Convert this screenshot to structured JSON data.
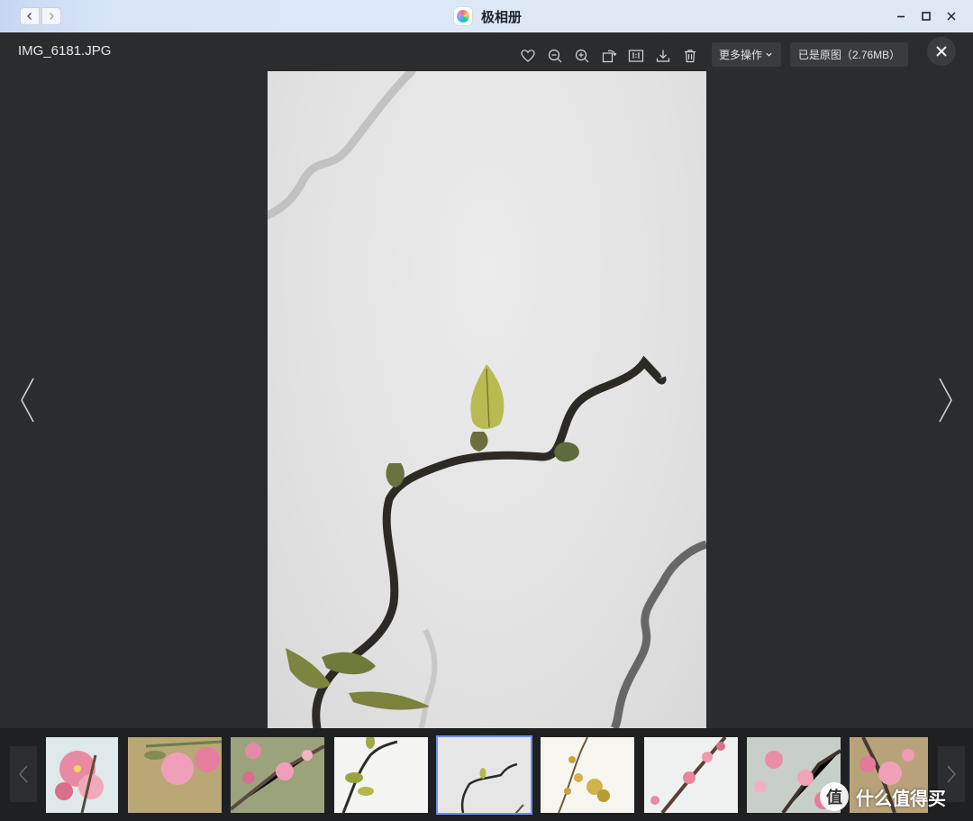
{
  "window": {
    "app_title": "极相册",
    "app_logo_icon": "app-logo-icon"
  },
  "viewer": {
    "file_name": "IMG_6181.JPG",
    "toolbar": {
      "more_actions_label": "更多操作",
      "original_badge": "已是原图（2.76MB）"
    },
    "photo": {
      "subject": "twig-with-new-leaves"
    }
  },
  "filmstrip": {
    "selected_index": 4,
    "thumbnails": [
      {
        "subject": "pink-peach-blossom"
      },
      {
        "subject": "pink-blossom-buds"
      },
      {
        "subject": "pink-blossoms-branch"
      },
      {
        "subject": "twig-leaves-white"
      },
      {
        "subject": "twig-leaves-selected"
      },
      {
        "subject": "yellow-leaves-branch"
      },
      {
        "subject": "pink-blossom-branch-white"
      },
      {
        "subject": "pink-blossoms-branch-2"
      },
      {
        "subject": "pink-blossom-closeup"
      }
    ]
  },
  "watermark": {
    "text": "什么值得买",
    "logo_text": "值"
  },
  "colors": {
    "titlebar": "#dbe6f6",
    "viewer_bg": "#2b2c2e",
    "filmstrip_bg": "#1f2022",
    "selection": "#6e8ef0"
  }
}
